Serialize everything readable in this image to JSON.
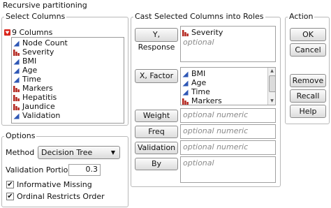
{
  "window_title": "Recursive partitioning",
  "select_columns": {
    "title": "Select Columns",
    "count_label": "9 Columns",
    "columns": [
      {
        "name": "Node Count",
        "type": "continuous"
      },
      {
        "name": "Severity",
        "type": "nominal"
      },
      {
        "name": "BMI",
        "type": "continuous"
      },
      {
        "name": "Age",
        "type": "continuous"
      },
      {
        "name": "Time",
        "type": "continuous"
      },
      {
        "name": "Markers",
        "type": "nominal"
      },
      {
        "name": "Hepatitis",
        "type": "nominal"
      },
      {
        "name": "Jaundice",
        "type": "nominal"
      },
      {
        "name": "Validation",
        "type": "continuous"
      }
    ]
  },
  "cast_roles": {
    "title": "Cast Selected Columns into Roles",
    "roles": {
      "y_response": {
        "button": "Y, Response",
        "items": [
          "Severity"
        ],
        "placeholder": "optional"
      },
      "x_factor": {
        "button": "X, Factor",
        "items": [
          "BMI",
          "Age",
          "Time",
          "Markers"
        ]
      },
      "weight": {
        "button": "Weight",
        "placeholder": "optional numeric"
      },
      "freq": {
        "button": "Freq",
        "placeholder": "optional numeric"
      },
      "validation": {
        "button": "Validation",
        "placeholder": "optional numeric"
      },
      "by": {
        "button": "By",
        "placeholder": "optional"
      }
    }
  },
  "action": {
    "title": "Action",
    "ok": "OK",
    "cancel": "Cancel",
    "remove": "Remove",
    "recall": "Recall",
    "help": "Help"
  },
  "options": {
    "title": "Options",
    "method_label": "Method",
    "method_value": "Decision Tree",
    "validation_portion_label": "Validation Portion",
    "validation_portion_value": "0.3",
    "informative_missing": {
      "label": "Informative Missing",
      "checked": true
    },
    "ordinal_restricts_order": {
      "label": "Ordinal Restricts Order",
      "checked": true
    }
  },
  "colors": {
    "continuous_icon": "#2e57b5",
    "nominal_icon": "#b3261e",
    "disclosure_icon": "#d9261c"
  }
}
